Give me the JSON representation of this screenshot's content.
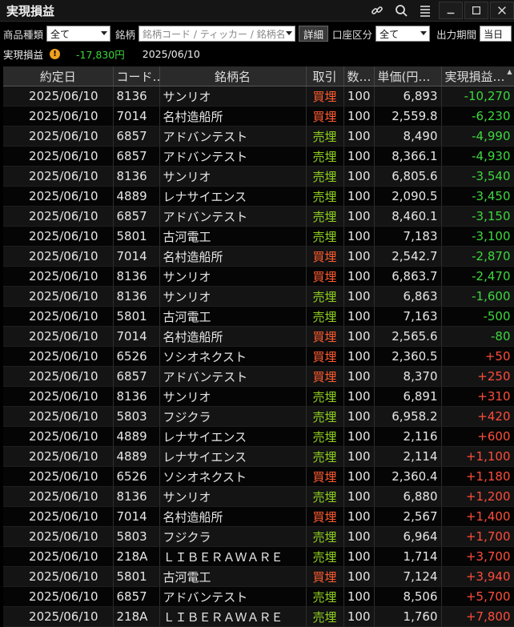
{
  "window": {
    "title": "実現損益",
    "icons": [
      "link-icon",
      "search-icon",
      "menu-icon",
      "minimize-icon",
      "maximize-icon",
      "close-icon"
    ]
  },
  "filters": {
    "product_label": "商品種類",
    "product_value": "全て",
    "stock_label": "銘柄",
    "stock_placeholder": "銘柄コード / ティッカー / 銘柄名",
    "detail_button": "詳細",
    "account_label": "口座区分",
    "account_value": "全て",
    "period_label": "出力期間",
    "period_value": "当日"
  },
  "summary": {
    "label": "実現損益",
    "total": "-17,830円",
    "date": "2025/06/10"
  },
  "colors": {
    "buy": "#ff5a2e",
    "sell": "#8fd11f",
    "loss": "#3dd73d",
    "profit": "#ff4b3b"
  },
  "table": {
    "columns": [
      "約定日",
      "コード…",
      "銘柄名",
      "取引",
      "数…",
      "単価(円…",
      "実現損益…"
    ],
    "rows": [
      {
        "date": "2025/06/10",
        "code": "8136",
        "name": "サンリオ",
        "side": "買埋",
        "qty": "100",
        "price": "6,893",
        "pl": "-10,270"
      },
      {
        "date": "2025/06/10",
        "code": "7014",
        "name": "名村造船所",
        "side": "買埋",
        "qty": "100",
        "price": "2,559.8",
        "pl": "-6,230"
      },
      {
        "date": "2025/06/10",
        "code": "6857",
        "name": "アドバンテスト",
        "side": "売埋",
        "qty": "100",
        "price": "8,490",
        "pl": "-4,990"
      },
      {
        "date": "2025/06/10",
        "code": "6857",
        "name": "アドバンテスト",
        "side": "売埋",
        "qty": "100",
        "price": "8,366.1",
        "pl": "-4,930"
      },
      {
        "date": "2025/06/10",
        "code": "8136",
        "name": "サンリオ",
        "side": "売埋",
        "qty": "100",
        "price": "6,805.6",
        "pl": "-3,540"
      },
      {
        "date": "2025/06/10",
        "code": "4889",
        "name": "レナサイエンス",
        "side": "売埋",
        "qty": "100",
        "price": "2,090.5",
        "pl": "-3,450"
      },
      {
        "date": "2025/06/10",
        "code": "6857",
        "name": "アドバンテスト",
        "side": "売埋",
        "qty": "100",
        "price": "8,460.1",
        "pl": "-3,150"
      },
      {
        "date": "2025/06/10",
        "code": "5801",
        "name": "古河電工",
        "side": "売埋",
        "qty": "100",
        "price": "7,183",
        "pl": "-3,100"
      },
      {
        "date": "2025/06/10",
        "code": "7014",
        "name": "名村造船所",
        "side": "買埋",
        "qty": "100",
        "price": "2,542.7",
        "pl": "-2,870"
      },
      {
        "date": "2025/06/10",
        "code": "8136",
        "name": "サンリオ",
        "side": "買埋",
        "qty": "100",
        "price": "6,863.7",
        "pl": "-2,470"
      },
      {
        "date": "2025/06/10",
        "code": "8136",
        "name": "サンリオ",
        "side": "売埋",
        "qty": "100",
        "price": "6,863",
        "pl": "-1,600"
      },
      {
        "date": "2025/06/10",
        "code": "5801",
        "name": "古河電工",
        "side": "売埋",
        "qty": "100",
        "price": "7,163",
        "pl": "-500"
      },
      {
        "date": "2025/06/10",
        "code": "7014",
        "name": "名村造船所",
        "side": "買埋",
        "qty": "100",
        "price": "2,565.6",
        "pl": "-80"
      },
      {
        "date": "2025/06/10",
        "code": "6526",
        "name": "ソシオネクスト",
        "side": "買埋",
        "qty": "100",
        "price": "2,360.5",
        "pl": "+50"
      },
      {
        "date": "2025/06/10",
        "code": "6857",
        "name": "アドバンテスト",
        "side": "買埋",
        "qty": "100",
        "price": "8,370",
        "pl": "+250"
      },
      {
        "date": "2025/06/10",
        "code": "8136",
        "name": "サンリオ",
        "side": "売埋",
        "qty": "100",
        "price": "6,891",
        "pl": "+310"
      },
      {
        "date": "2025/06/10",
        "code": "5803",
        "name": "フジクラ",
        "side": "売埋",
        "qty": "100",
        "price": "6,958.2",
        "pl": "+420"
      },
      {
        "date": "2025/06/10",
        "code": "4889",
        "name": "レナサイエンス",
        "side": "売埋",
        "qty": "100",
        "price": "2,116",
        "pl": "+600"
      },
      {
        "date": "2025/06/10",
        "code": "4889",
        "name": "レナサイエンス",
        "side": "売埋",
        "qty": "100",
        "price": "2,114",
        "pl": "+1,100"
      },
      {
        "date": "2025/06/10",
        "code": "6526",
        "name": "ソシオネクスト",
        "side": "買埋",
        "qty": "100",
        "price": "2,360.4",
        "pl": "+1,180"
      },
      {
        "date": "2025/06/10",
        "code": "8136",
        "name": "サンリオ",
        "side": "売埋",
        "qty": "100",
        "price": "6,880",
        "pl": "+1,200"
      },
      {
        "date": "2025/06/10",
        "code": "7014",
        "name": "名村造船所",
        "side": "買埋",
        "qty": "100",
        "price": "2,567",
        "pl": "+1,400"
      },
      {
        "date": "2025/06/10",
        "code": "5803",
        "name": "フジクラ",
        "side": "売埋",
        "qty": "100",
        "price": "6,964",
        "pl": "+1,700"
      },
      {
        "date": "2025/06/10",
        "code": "218A",
        "name": "ＬＩＢＥＲＡＷＡＲＥ",
        "side": "売埋",
        "qty": "100",
        "price": "1,714",
        "pl": "+3,700"
      },
      {
        "date": "2025/06/10",
        "code": "5801",
        "name": "古河電工",
        "side": "買埋",
        "qty": "100",
        "price": "7,124",
        "pl": "+3,940"
      },
      {
        "date": "2025/06/10",
        "code": "6857",
        "name": "アドバンテスト",
        "side": "売埋",
        "qty": "100",
        "price": "8,506",
        "pl": "+5,700"
      },
      {
        "date": "2025/06/10",
        "code": "218A",
        "name": "ＬＩＢＥＲＡＷＡＲＥ",
        "side": "売埋",
        "qty": "100",
        "price": "1,760",
        "pl": "+7,800"
      }
    ]
  }
}
